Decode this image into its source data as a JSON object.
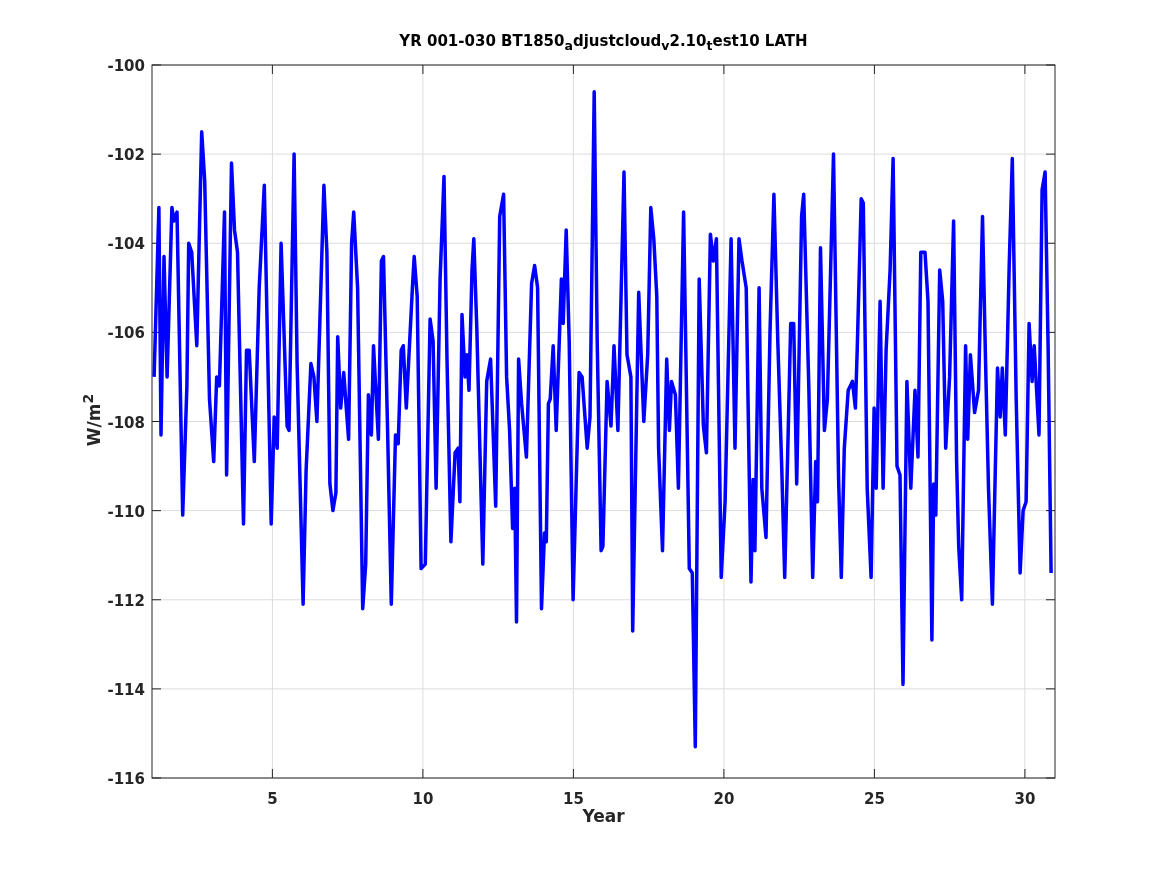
{
  "chart_data": {
    "type": "line",
    "grid": true,
    "title": "YR 001-030 BT1850$_{a}$djustcloud$_{v}$2.10$_{t}$est10 LATH",
    "xlabel": "Year",
    "ylabel": "W/m$^{2}$",
    "xlim": [
      1,
      31
    ],
    "ylim": [
      -116,
      -100
    ],
    "xticks": [
      5,
      10,
      15,
      20,
      25,
      30
    ],
    "yticks": [
      -116,
      -114,
      -112,
      -110,
      -108,
      -106,
      -104,
      -102,
      -100
    ],
    "x": [
      1.07,
      1.23,
      1.3,
      1.4,
      1.5,
      1.66,
      1.73,
      1.83,
      2.02,
      2.16,
      2.22,
      2.32,
      2.49,
      2.65,
      2.75,
      2.91,
      3.05,
      3.15,
      3.24,
      3.41,
      3.48,
      3.64,
      3.74,
      3.84,
      4.04,
      4.14,
      4.23,
      4.4,
      4.56,
      4.73,
      4.96,
      5.06,
      5.16,
      5.29,
      5.49,
      5.55,
      5.72,
      5.82,
      6.02,
      6.12,
      6.28,
      6.38,
      6.48,
      6.71,
      6.81,
      6.91,
      7.01,
      7.11,
      7.17,
      7.27,
      7.37,
      7.53,
      7.63,
      7.7,
      7.83,
      8.0,
      8.1,
      8.19,
      8.29,
      8.36,
      8.52,
      8.62,
      8.69,
      8.82,
      8.95,
      9.09,
      9.18,
      9.28,
      9.35,
      9.45,
      9.65,
      9.71,
      9.81,
      9.94,
      10.08,
      10.24,
      10.34,
      10.44,
      10.57,
      10.7,
      10.8,
      10.93,
      11.07,
      11.17,
      11.23,
      11.3,
      11.4,
      11.46,
      11.53,
      11.63,
      11.69,
      11.79,
      11.99,
      12.12,
      12.25,
      12.42,
      12.55,
      12.68,
      12.78,
      12.88,
      12.98,
      13.05,
      13.11,
      13.18,
      13.28,
      13.44,
      13.61,
      13.71,
      13.81,
      13.94,
      14.04,
      14.1,
      14.17,
      14.23,
      14.33,
      14.43,
      14.6,
      14.66,
      14.76,
      14.86,
      14.99,
      15.19,
      15.29,
      15.46,
      15.55,
      15.69,
      15.79,
      15.92,
      15.98,
      16.12,
      16.25,
      16.35,
      16.48,
      16.68,
      16.78,
      16.91,
      16.97,
      17.17,
      17.34,
      17.47,
      17.57,
      17.67,
      17.77,
      17.83,
      17.96,
      18.1,
      18.19,
      18.26,
      18.39,
      18.49,
      18.66,
      18.76,
      18.85,
      18.95,
      19.05,
      19.18,
      19.32,
      19.42,
      19.55,
      19.65,
      19.75,
      19.91,
      20.04,
      20.24,
      20.37,
      20.5,
      20.6,
      20.74,
      20.9,
      20.97,
      21.03,
      21.17,
      21.26,
      21.4,
      21.53,
      21.66,
      21.79,
      21.92,
      22.02,
      22.12,
      22.22,
      22.32,
      22.42,
      22.58,
      22.65,
      22.82,
      22.95,
      23.05,
      23.11,
      23.21,
      23.34,
      23.44,
      23.64,
      23.81,
      23.9,
      24.0,
      24.13,
      24.2,
      24.27,
      24.37,
      24.43,
      24.56,
      24.63,
      24.76,
      24.89,
      24.99,
      25.06,
      25.19,
      25.29,
      25.39,
      25.52,
      25.62,
      25.75,
      25.85,
      25.95,
      26.08,
      26.21,
      26.35,
      26.45,
      26.54,
      26.68,
      26.78,
      26.91,
      26.97,
      27.04,
      27.17,
      27.27,
      27.37,
      27.5,
      27.63,
      27.73,
      27.8,
      27.9,
      28.03,
      28.1,
      28.19,
      28.33,
      28.46,
      28.59,
      28.69,
      28.79,
      28.92,
      29.09,
      29.18,
      29.25,
      29.35,
      29.48,
      29.58,
      29.71,
      29.84,
      29.94,
      30.04,
      30.14,
      30.24,
      30.31,
      30.47,
      30.57,
      30.67,
      30.77,
      30.87
    ],
    "series": [
      {
        "color": "#0000ff",
        "values": [
          -107.0,
          -103.2,
          -108.3,
          -104.3,
          -107.0,
          -103.2,
          -103.5,
          -103.3,
          -110.1,
          -107.2,
          -104.0,
          -104.2,
          -106.3,
          -101.5,
          -102.6,
          -107.5,
          -108.9,
          -107.0,
          -107.2,
          -103.3,
          -109.2,
          -102.2,
          -103.7,
          -104.2,
          -110.3,
          -106.4,
          -106.4,
          -108.9,
          -105.0,
          -102.7,
          -110.3,
          -107.9,
          -108.6,
          -104.0,
          -108.1,
          -108.2,
          -102.0,
          -106.7,
          -112.1,
          -109.1,
          -106.7,
          -107.0,
          -108.0,
          -102.7,
          -104.2,
          -109.4,
          -110.0,
          -109.6,
          -106.1,
          -107.7,
          -106.9,
          -108.4,
          -104.0,
          -103.3,
          -105.0,
          -112.2,
          -111.2,
          -107.4,
          -108.3,
          -106.3,
          -108.4,
          -104.4,
          -104.3,
          -108.0,
          -112.1,
          -108.3,
          -108.5,
          -106.4,
          -106.3,
          -107.7,
          -105.0,
          -104.3,
          -105.2,
          -111.3,
          -111.2,
          -105.7,
          -106.2,
          -109.5,
          -104.8,
          -102.5,
          -106.6,
          -110.7,
          -108.7,
          -108.6,
          -109.8,
          -105.6,
          -107.0,
          -106.5,
          -107.3,
          -104.6,
          -103.9,
          -105.9,
          -111.2,
          -107.1,
          -106.6,
          -109.9,
          -103.4,
          -102.9,
          -107.0,
          -108.2,
          -110.4,
          -109.5,
          -112.5,
          -106.6,
          -107.6,
          -108.8,
          -104.9,
          -104.5,
          -105.0,
          -112.2,
          -110.5,
          -110.7,
          -107.6,
          -107.5,
          -106.3,
          -108.2,
          -104.8,
          -105.8,
          -103.7,
          -106.2,
          -112.0,
          -106.9,
          -107.0,
          -108.6,
          -107.9,
          -100.6,
          -106.2,
          -110.9,
          -110.8,
          -107.1,
          -108.1,
          -106.3,
          -108.2,
          -102.4,
          -106.5,
          -107.0,
          -112.7,
          -105.1,
          -108.0,
          -106.5,
          -103.2,
          -103.9,
          -105.2,
          -108.6,
          -110.9,
          -106.6,
          -108.2,
          -107.1,
          -107.4,
          -109.5,
          -103.3,
          -107.5,
          -111.3,
          -111.4,
          -115.3,
          -104.8,
          -108.1,
          -108.7,
          -103.8,
          -104.4,
          -103.9,
          -111.5,
          -109.8,
          -103.9,
          -108.6,
          -103.9,
          -104.4,
          -105.0,
          -111.6,
          -109.3,
          -110.9,
          -105.0,
          -109.5,
          -110.6,
          -106.0,
          -102.9,
          -106.2,
          -109.0,
          -111.5,
          -108.7,
          -105.8,
          -105.8,
          -109.4,
          -103.4,
          -102.9,
          -107.2,
          -111.5,
          -108.9,
          -109.8,
          -104.1,
          -108.2,
          -107.5,
          -102.0,
          -109.3,
          -111.5,
          -108.6,
          -107.3,
          -107.2,
          -107.1,
          -107.7,
          -106.4,
          -103.0,
          -103.1,
          -109.5,
          -111.5,
          -107.7,
          -109.5,
          -105.3,
          -109.5,
          -106.4,
          -104.6,
          -102.1,
          -109.0,
          -109.2,
          -113.9,
          -107.1,
          -109.5,
          -107.3,
          -108.8,
          -104.2,
          -104.2,
          -105.3,
          -112.9,
          -109.4,
          -110.1,
          -104.6,
          -105.3,
          -108.6,
          -107.0,
          -103.5,
          -108.9,
          -110.8,
          -112.0,
          -106.3,
          -108.4,
          -106.5,
          -107.8,
          -107.3,
          -103.4,
          -106.6,
          -109.5,
          -112.1,
          -106.8,
          -107.9,
          -106.8,
          -108.3,
          -104.5,
          -102.1,
          -107.5,
          -111.4,
          -110.0,
          -109.8,
          -105.8,
          -107.1,
          -106.3,
          -108.3,
          -102.8,
          -102.4,
          -106.3,
          -111.4
        ]
      }
    ]
  }
}
